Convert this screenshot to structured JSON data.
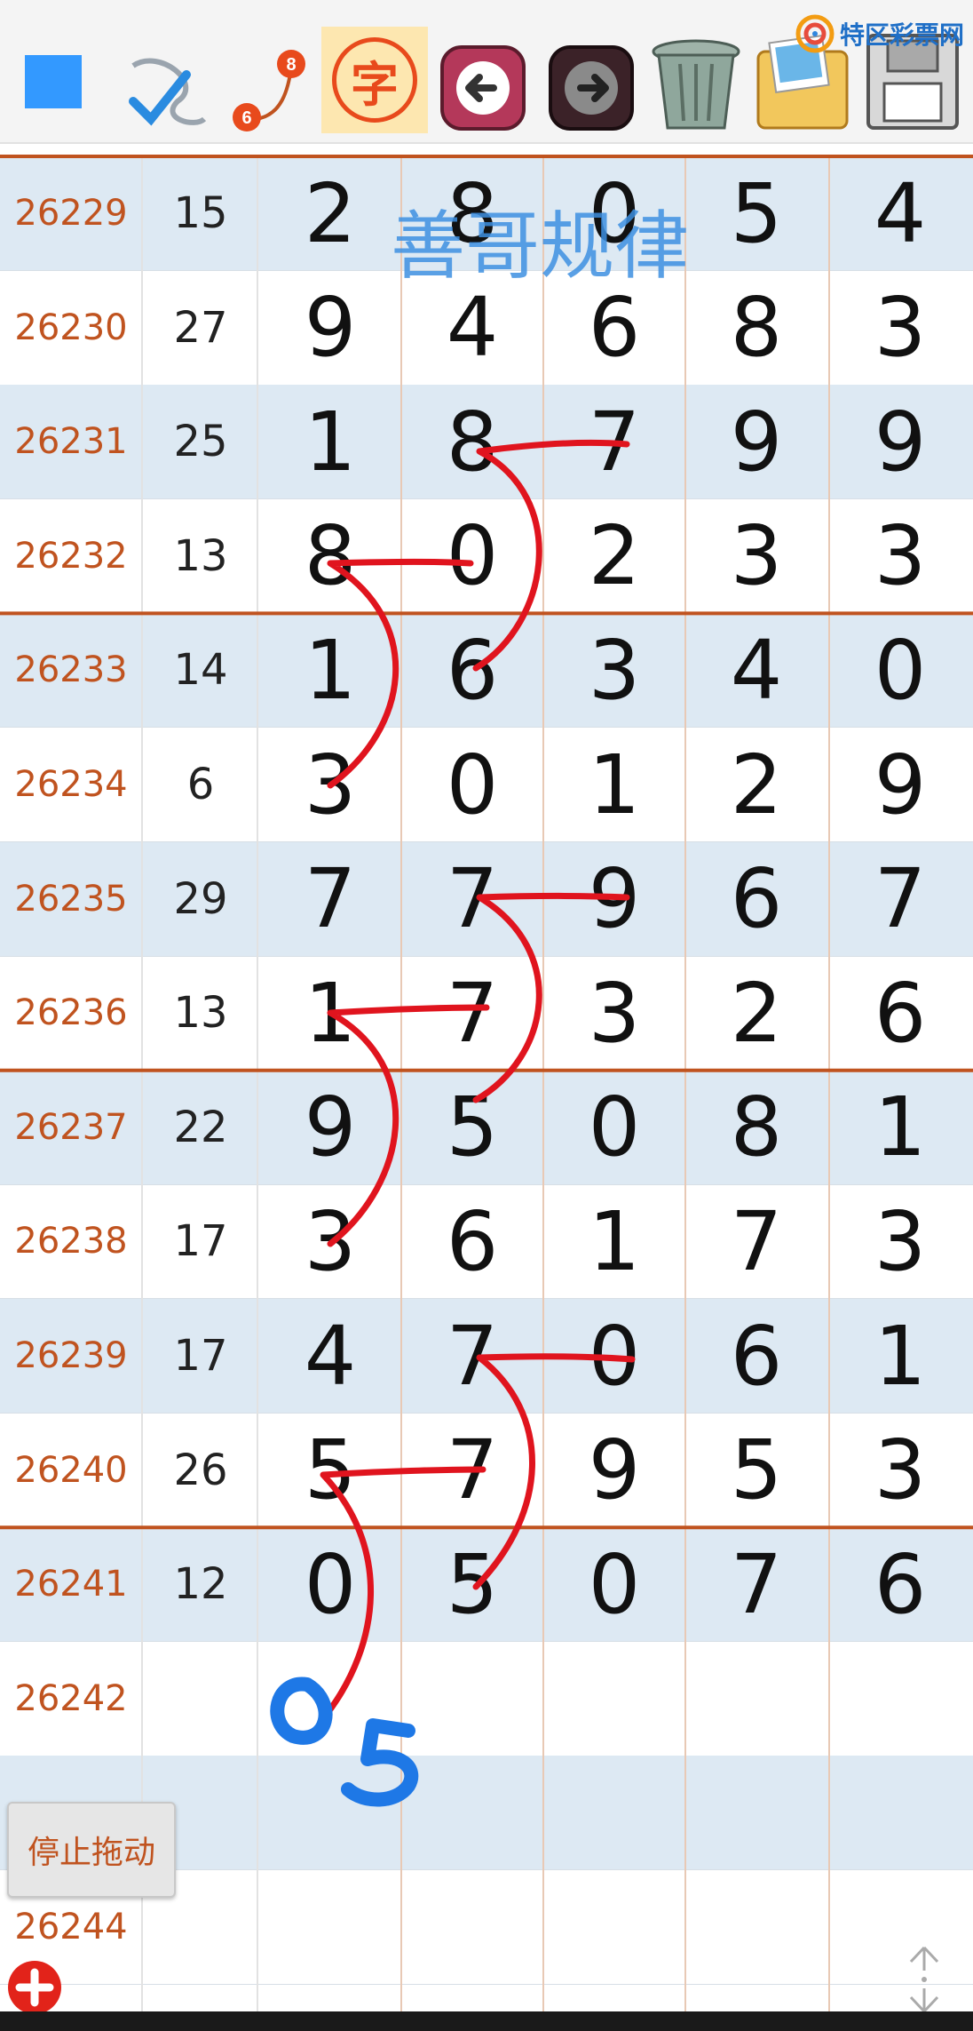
{
  "toolbar": {
    "icons": [
      "square-select-icon",
      "pen-check-icon",
      "connect-points-icon",
      "text-tool-icon",
      "undo-arrow-icon",
      "redo-arrow-icon",
      "trash-can-icon",
      "photo-folder-icon",
      "save-disk-icon"
    ],
    "connect_label_top": "8",
    "connect_label_bottom": "6",
    "text_tool_char": "字",
    "logo_text": "特区彩票网"
  },
  "watermark": "善哥规律",
  "colors": {
    "accent_red": "#e0141e",
    "handwriting_blue": "#1e78e6",
    "issue_text": "#c0531f",
    "divider": "#c0531f",
    "row_shade": "#dde9f3"
  },
  "rows": [
    {
      "issue": "26229",
      "sum": "15",
      "digits": [
        "2",
        "8",
        "0",
        "5",
        "4"
      ]
    },
    {
      "issue": "26230",
      "sum": "27",
      "digits": [
        "9",
        "4",
        "6",
        "8",
        "3"
      ]
    },
    {
      "issue": "26231",
      "sum": "25",
      "digits": [
        "1",
        "8",
        "7",
        "9",
        "9"
      ]
    },
    {
      "issue": "26232",
      "sum": "13",
      "digits": [
        "8",
        "0",
        "2",
        "3",
        "3"
      ]
    },
    {
      "issue": "26233",
      "sum": "14",
      "digits": [
        "1",
        "6",
        "3",
        "4",
        "0"
      ]
    },
    {
      "issue": "26234",
      "sum": "6",
      "digits": [
        "3",
        "0",
        "1",
        "2",
        "9"
      ]
    },
    {
      "issue": "26235",
      "sum": "29",
      "digits": [
        "7",
        "7",
        "9",
        "6",
        "7"
      ]
    },
    {
      "issue": "26236",
      "sum": "13",
      "digits": [
        "1",
        "7",
        "3",
        "2",
        "6"
      ]
    },
    {
      "issue": "26237",
      "sum": "22",
      "digits": [
        "9",
        "5",
        "0",
        "8",
        "1"
      ]
    },
    {
      "issue": "26238",
      "sum": "17",
      "digits": [
        "3",
        "6",
        "1",
        "7",
        "3"
      ]
    },
    {
      "issue": "26239",
      "sum": "17",
      "digits": [
        "4",
        "7",
        "0",
        "6",
        "1"
      ]
    },
    {
      "issue": "26240",
      "sum": "26",
      "digits": [
        "5",
        "7",
        "9",
        "5",
        "3"
      ]
    },
    {
      "issue": "26241",
      "sum": "12",
      "digits": [
        "0",
        "5",
        "0",
        "7",
        "6"
      ]
    },
    {
      "issue": "26242",
      "sum": "",
      "digits": [
        "",
        "",
        "",
        "",
        ""
      ]
    },
    {
      "issue": "",
      "sum": "",
      "digits": [
        "",
        "",
        "",
        "",
        ""
      ]
    },
    {
      "issue": "26244",
      "sum": "",
      "digits": [
        "",
        "",
        "",
        "",
        ""
      ]
    }
  ],
  "handwritten_prediction": "05",
  "stop_drag_label": "停止拖动",
  "add_icon": "plus-circle-icon",
  "scroll_icon": "vertical-resize-icon"
}
